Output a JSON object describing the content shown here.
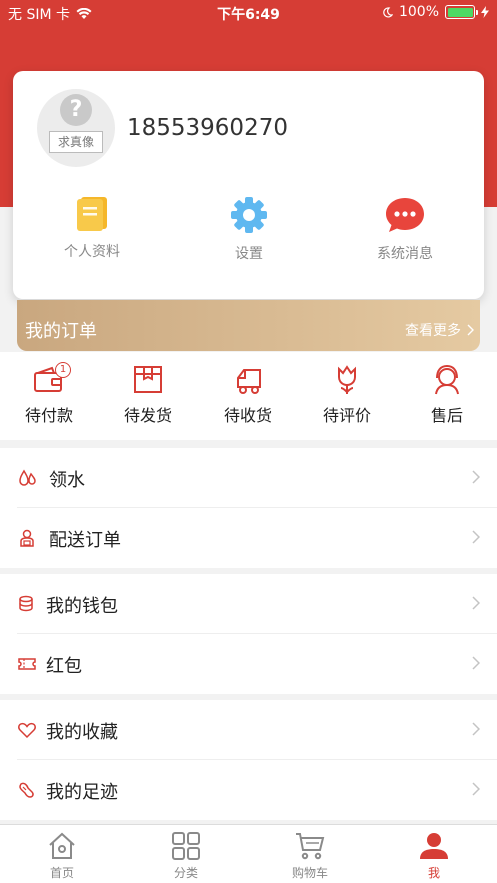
{
  "status_bar": {
    "carrier": "无 SIM 卡",
    "time": "下午6:49",
    "battery": "100%",
    "battery_level": 1.0
  },
  "profile": {
    "avatar_label": "求真像",
    "avatar_mark": "?",
    "phone": "18553960270"
  },
  "quick_actions": [
    {
      "label": "个人资料",
      "icon": "document-icon"
    },
    {
      "label": "设置",
      "icon": "gear-icon"
    },
    {
      "label": "系统消息",
      "icon": "chat-bubble-icon"
    }
  ],
  "orders": {
    "title": "我的订单",
    "more": "查看更多",
    "items": [
      {
        "label": "待付款",
        "icon": "wallet-icon",
        "badge": "1"
      },
      {
        "label": "待发货",
        "icon": "box-icon"
      },
      {
        "label": "待收货",
        "icon": "truck-icon"
      },
      {
        "label": "待评价",
        "icon": "flower-icon"
      },
      {
        "label": "售后",
        "icon": "service-icon"
      }
    ]
  },
  "menu_groups": [
    [
      {
        "label": "领水",
        "icon": "water-drop-icon"
      },
      {
        "label": "配送订单",
        "icon": "courier-icon"
      }
    ],
    [
      {
        "label": "我的钱包",
        "icon": "coins-icon"
      },
      {
        "label": "红包",
        "icon": "ticket-icon"
      }
    ],
    [
      {
        "label": "我的收藏",
        "icon": "heart-icon"
      },
      {
        "label": "我的足迹",
        "icon": "footprint-icon"
      }
    ]
  ],
  "tabbar": [
    {
      "label": "首页",
      "icon": "home-icon",
      "active": false
    },
    {
      "label": "分类",
      "icon": "grid-icon",
      "active": false
    },
    {
      "label": "购物车",
      "icon": "cart-icon",
      "active": false
    },
    {
      "label": "我",
      "icon": "person-icon",
      "active": true
    }
  ],
  "colors": {
    "accent": "#d63d35",
    "gold_start": "#c9a77f",
    "gold_end": "#e5caa2"
  }
}
